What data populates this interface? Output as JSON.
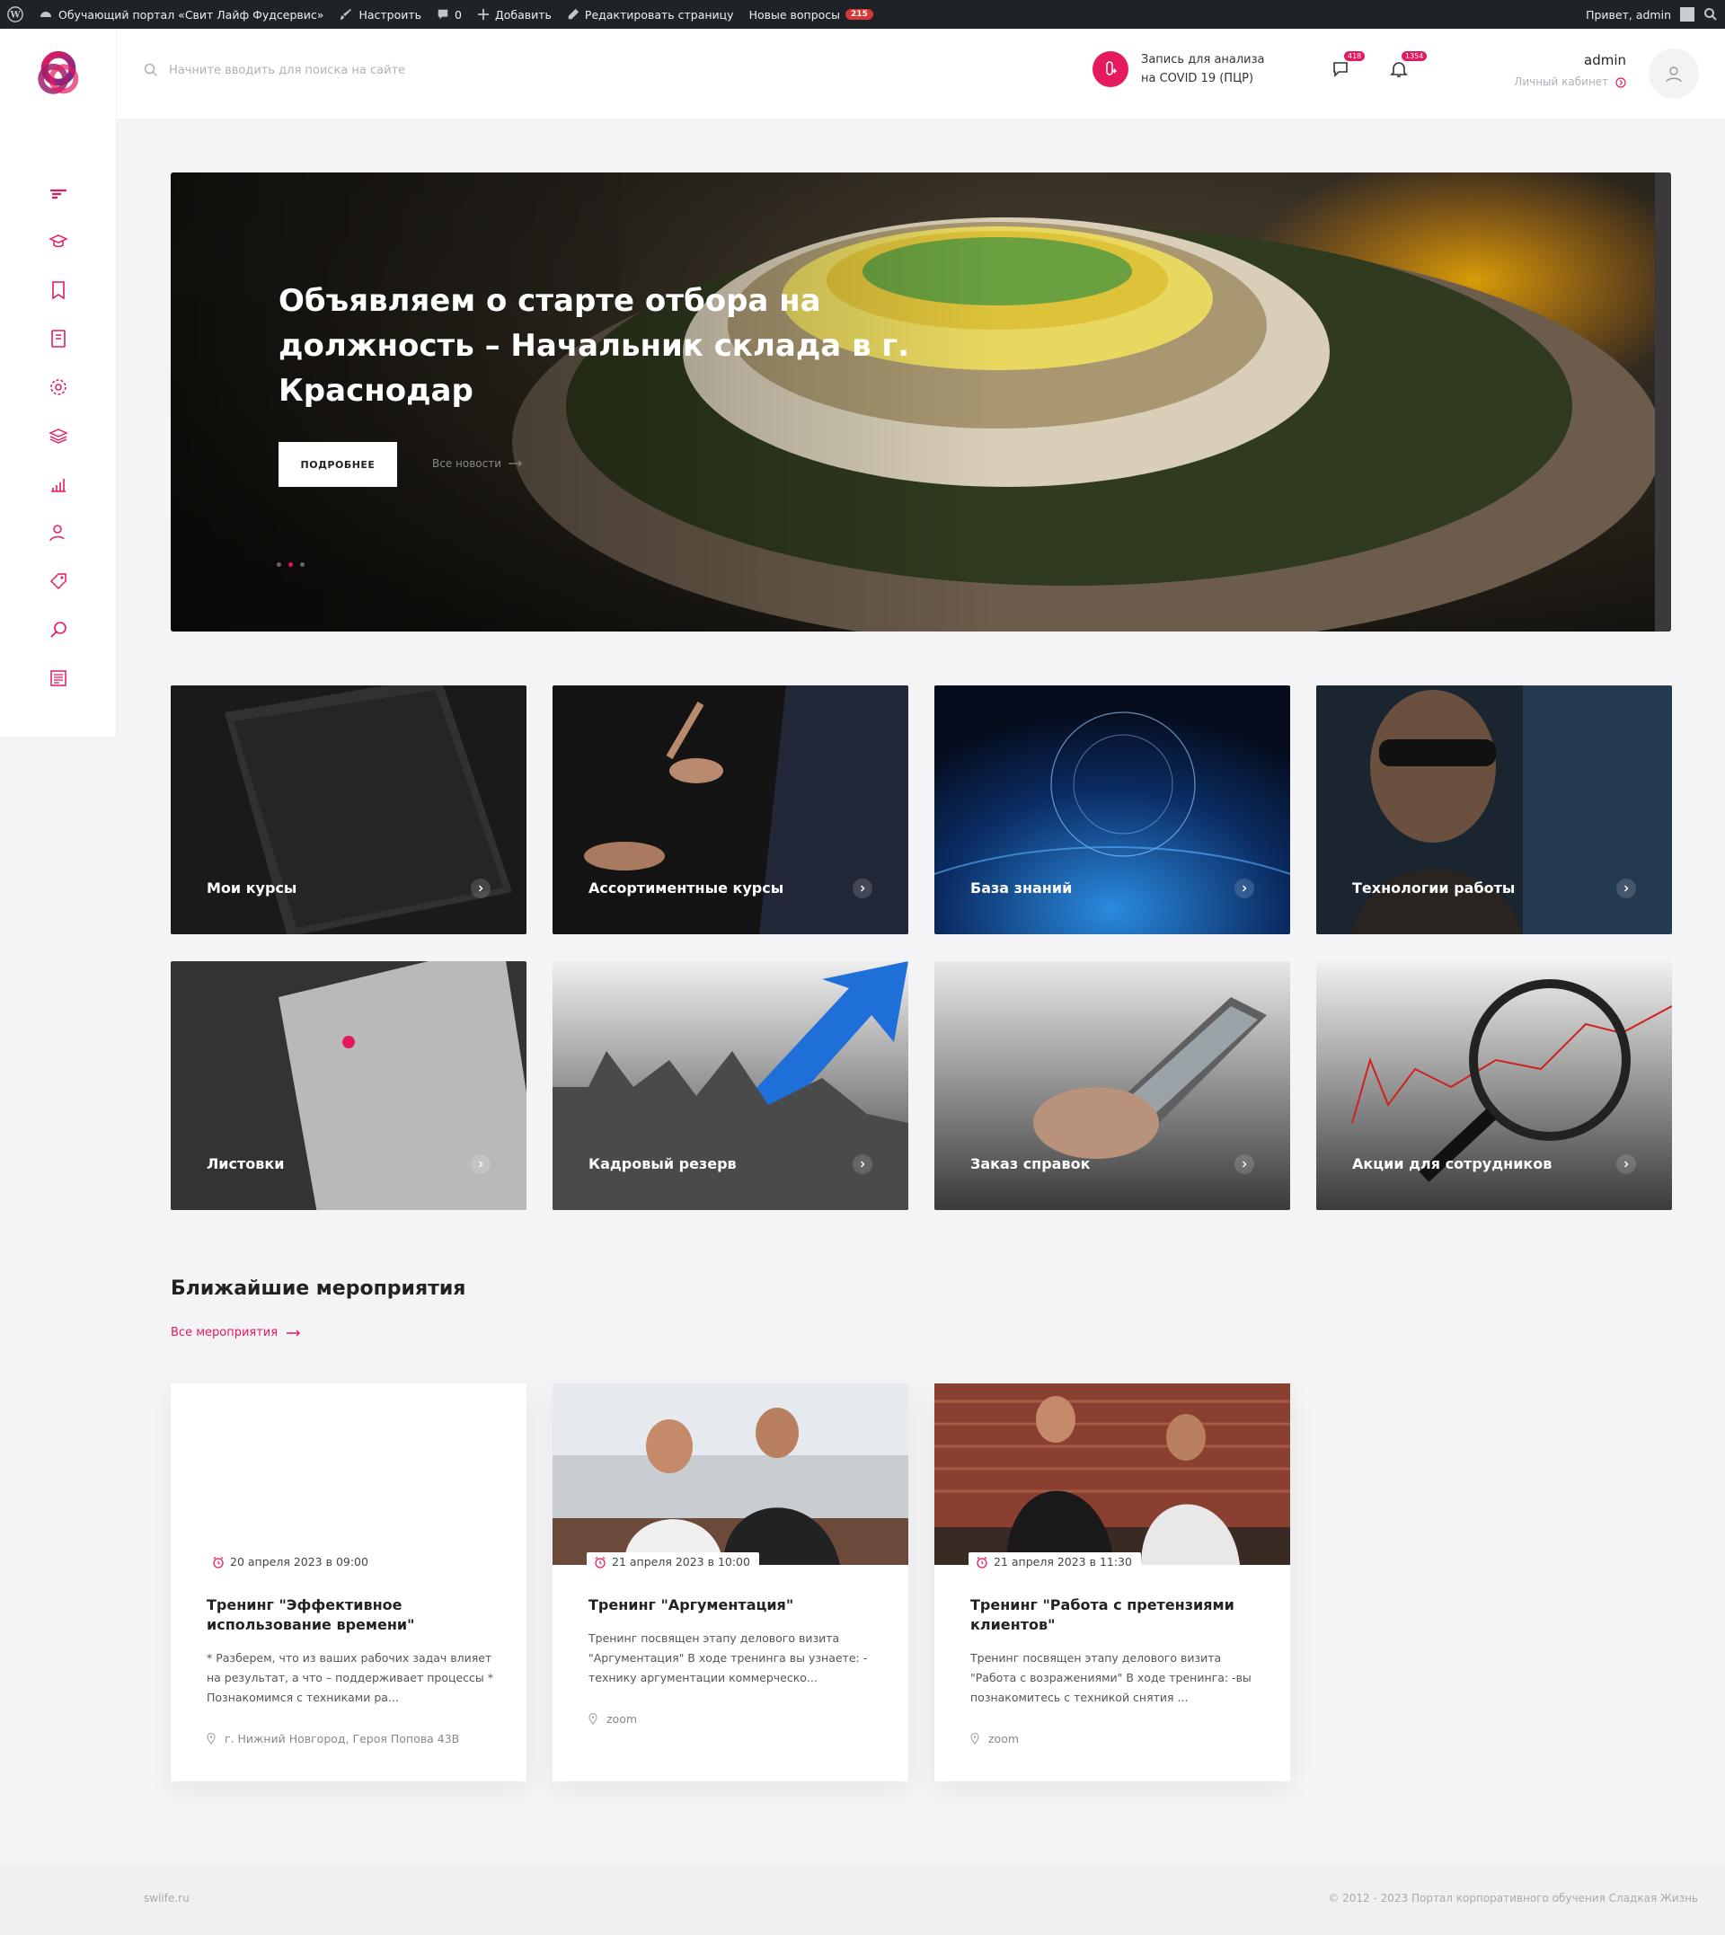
{
  "admin_bar": {
    "site_name": "Обучающий портал «Свит Лайф Фудсервис»",
    "customize": "Настроить",
    "comments_count": "0",
    "add": "Добавить",
    "edit_page": "Редактировать страницу",
    "new_questions": "Новые вопросы",
    "new_questions_count": "215",
    "greeting": "Привет, admin"
  },
  "header": {
    "search_placeholder": "Начните вводить для поиска на сайте",
    "covid_line1": "Запись для анализа",
    "covid_line2": "на COVID 19 (ПЦР)",
    "messages_count": "418",
    "notifications_count": "1354",
    "user_name": "admin",
    "cabinet_link": "Личный кабинет"
  },
  "sidebar": {
    "icons": [
      "dashboard-icon",
      "graduation-cap-icon",
      "bookmark-icon",
      "book-icon",
      "gear-icon",
      "layers-icon",
      "chart-icon",
      "user-icon",
      "tag-icon",
      "search-icon",
      "news-icon"
    ]
  },
  "hero": {
    "title": "Объявляем о старте отбора на должность – Начальник склада в г. Краснодар",
    "button": "ПОДРОБНЕЕ",
    "all_news": "Все новости"
  },
  "tiles": [
    {
      "label": "Мои курсы"
    },
    {
      "label": "Ассортиментные курсы"
    },
    {
      "label": "База знаний"
    },
    {
      "label": "Технологии работы"
    },
    {
      "label": "Листовки"
    },
    {
      "label": "Кадровый резерв"
    },
    {
      "label": "Заказ справок"
    },
    {
      "label": "Акции для сотрудников"
    }
  ],
  "events": {
    "title": "Ближайшие мероприятия",
    "all_link": "Все мероприятия",
    "items": [
      {
        "date": "20 апреля 2023 в 09:00",
        "title": "Тренинг \"Эффективное использование времени\"",
        "desc": "* Разберем, что из ваших рабочих задач влияет на результат, а что – поддерживает процессы * Познакомимся с техниками ра...",
        "location": "г. Нижний Новгород, Героя Попова 43В"
      },
      {
        "date": "21 апреля 2023 в 10:00",
        "title": "Тренинг \"Аргументация\"",
        "desc": "Тренинг посвящен этапу делового визита \"Аргументация\" В ходе тренинга вы узнаете: - технику аргументации коммерческо...",
        "location": "zoom"
      },
      {
        "date": "21 апреля 2023 в 11:30",
        "title": "Тренинг \"Работа с претензиями клиентов\"",
        "desc": "Тренинг посвящен этапу делового визита \"Работа с возражениями\" В ходе тренинга: -вы познакомитесь с техникой снятия ...",
        "location": "zoom"
      }
    ]
  },
  "footer": {
    "site": "swlife.ru",
    "copyright": "© 2012 - 2023 Портал корпоративного обучения Сладкая Жизнь"
  },
  "colors": {
    "accent": "#e5195e",
    "admin_bar": "#1d2327"
  }
}
